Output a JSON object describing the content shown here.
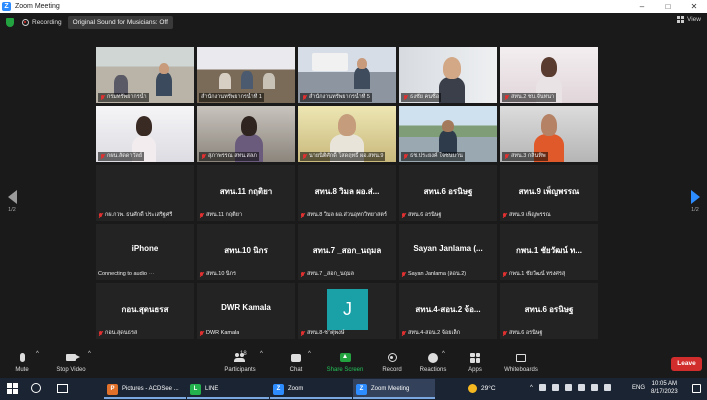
{
  "window": {
    "title": "Zoom Meeting"
  },
  "top_strip": {
    "recording_label": "Recording",
    "original_sound_label": "Original Sound for Musicians: Off",
    "view_label": "View"
  },
  "nav": {
    "left_page": "1/2",
    "right_page": "1/2"
  },
  "tiles": [
    {
      "name": "กรมทรัพยากรน้ำ",
      "center": "",
      "video": true
    },
    {
      "name": "สำนักงานทรัพยากรน้ำที่ 1",
      "center": "",
      "video": true
    },
    {
      "name": "สำนักงานทรัพยากรน้ำที่ 5",
      "center": "",
      "video": true
    },
    {
      "name": "ธงชัย คนซื่อ",
      "center": "",
      "video": true
    },
    {
      "name": "สทน.2 ชบ.จันทนา",
      "center": "",
      "video": true
    },
    {
      "name": "กผน.ลัดดาวัลย์",
      "center": "",
      "video": true
    },
    {
      "name": "สุภาพรรณ สทน.สลภ",
      "center": "",
      "video": true
    },
    {
      "name": "นายนิติศักดิ์ โสดฤทธิ์ ผอ.สทน.9",
      "center": "",
      "video": true
    },
    {
      "name": "ธช.ประยงค์ ใจชนบาน",
      "center": "",
      "video": true
    },
    {
      "name": "สทน.3 กลิ่นทิพ",
      "center": "",
      "video": true
    },
    {
      "name": "กผ.กวพ. ธนศักดิ์ ประเสริฐศรี",
      "center": "",
      "video": false
    },
    {
      "name": "สทน.11 กฤติยา",
      "center": "สทน.11 กฤติยา",
      "video": false
    },
    {
      "name": "สทน.8 วิมล ผอ.ส่วนอุทกวิทยาสตร์",
      "center": "สทน.8 วิมล ผอ.ส่...",
      "video": false
    },
    {
      "name": "สทน.6 อรนิษฐ",
      "center": "สทน.6 อรนิษฐ",
      "video": false
    },
    {
      "name": "สทน.9 เพ็ญพรรณ",
      "center": "สทน.9 เพ็ญพรรณ",
      "video": false
    },
    {
      "name": "Connecting to audio",
      "center": "iPhone",
      "video": false,
      "connecting": true
    },
    {
      "name": "สทน.10 นิกร",
      "center": "สทน.10 นิกร",
      "video": false
    },
    {
      "name": "สทน.7 _สอก_นฤมล",
      "center": "สทน.7 _สอก_นฤมล",
      "video": false
    },
    {
      "name": "Sayan Janlama (ลอน.2)",
      "center": "Sayan Janlama (...",
      "video": false
    },
    {
      "name": "กพน.1 ชัยวัฒน์ ทรงศรสุ",
      "center": "กพน.1 ชัยวัฒน์ ท...",
      "video": false
    },
    {
      "name": "กอน.สุดนธรส",
      "center": "กอน.สุดนธรส",
      "video": false
    },
    {
      "name": "DWR Kamala",
      "center": "DWR Kamala",
      "video": false
    },
    {
      "name": "สทน.8-ชาตุพงษ์",
      "center": "",
      "video": false,
      "avatar": "J"
    },
    {
      "name": "สทน.4-สอน.2 จ้อยเล็ก",
      "center": "สทน.4-สอน.2 จ้อ...",
      "video": false
    },
    {
      "name": "สทน.6 อรนิษฐ",
      "center": "สทน.6 อรนิษฐ",
      "video": false
    }
  ],
  "toolbar": {
    "mute": "Mute",
    "stop_video": "Stop Video",
    "participants": "Participants",
    "participant_count": "18",
    "chat": "Chat",
    "share_screen": "Share Screen",
    "record": "Record",
    "reactions": "Reactions",
    "apps": "Apps",
    "whiteboards": "Whiteboards",
    "leave": "Leave"
  },
  "taskbar": {
    "apps": [
      {
        "label": "Pictures - ACDSee ...",
        "icon": "acdsee-icon",
        "color": "#e0702a",
        "active": false
      },
      {
        "label": "LINE",
        "icon": "line-icon",
        "color": "#22b14c",
        "active": false
      },
      {
        "label": "Zoom",
        "icon": "zoom-icon",
        "color": "#2d8cff",
        "active": false
      },
      {
        "label": "Zoom Meeting",
        "icon": "zoom-icon",
        "color": "#2d8cff",
        "active": true
      }
    ],
    "temperature": "29°C",
    "language": "ENG",
    "time": "10:05 AM",
    "date": "8/17/2023"
  },
  "colors": {
    "accent": "#2d8cff",
    "active_speaker": "#a6d64a",
    "leave": "#d22d2d",
    "share": "#23a340"
  }
}
